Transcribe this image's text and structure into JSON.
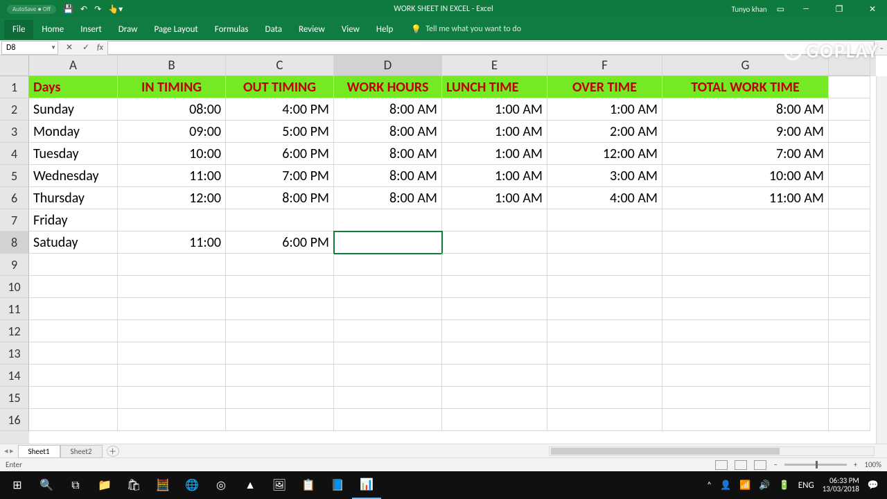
{
  "titlebar": {
    "autosave": "AutoSave ● Off",
    "doc_title": "WORK SHEET IN EXCEL - Excel",
    "user": "Tunyo khan"
  },
  "watermark": "GOPLAY",
  "ribbon": {
    "tabs": [
      "File",
      "Home",
      "Insert",
      "Draw",
      "Page Layout",
      "Formulas",
      "Data",
      "Review",
      "View",
      "Help"
    ],
    "tell_me": "Tell me what you want to do"
  },
  "formula": {
    "name_box": "D8",
    "fx": "fx"
  },
  "columns": [
    "A",
    "B",
    "C",
    "D",
    "E",
    "F",
    "G"
  ],
  "selected_col": "D",
  "selected_row": "8",
  "selected_cell": "D8",
  "row_count": 16,
  "headers": [
    "Days",
    "IN TIMING",
    "OUT TIMING",
    "WORK HOURS",
    "LUNCH TIME",
    "OVER TIME",
    "TOTAL WORK TIME"
  ],
  "rows": [
    {
      "A": "Sunday",
      "B": "08:00",
      "C": "4:00 PM",
      "D": "8:00 AM",
      "E": "1:00 AM",
      "F": "1:00 AM",
      "G": "8:00 AM"
    },
    {
      "A": "Monday",
      "B": "09:00",
      "C": "5:00 PM",
      "D": "8:00 AM",
      "E": "1:00 AM",
      "F": "2:00 AM",
      "G": "9:00 AM"
    },
    {
      "A": "Tuesday",
      "B": "10:00",
      "C": "6:00 PM",
      "D": "8:00 AM",
      "E": "1:00 AM",
      "F": "12:00 AM",
      "G": "7:00 AM"
    },
    {
      "A": "Wednesday",
      "B": "11:00",
      "C": "7:00 PM",
      "D": "8:00 AM",
      "E": "1:00 AM",
      "F": "3:00 AM",
      "G": "10:00 AM"
    },
    {
      "A": "Thursday",
      "B": "12:00",
      "C": "8:00 PM",
      "D": "8:00 AM",
      "E": "1:00 AM",
      "F": "4:00 AM",
      "G": "11:00 AM"
    },
    {
      "A": "Friday",
      "B": "",
      "C": "",
      "D": "",
      "E": "",
      "F": "",
      "G": ""
    },
    {
      "A": "Satuday",
      "B": "11:00",
      "C": "6:00 PM",
      "D": "",
      "E": "",
      "F": "",
      "G": ""
    }
  ],
  "sheets": {
    "active": "Sheet1",
    "list": [
      "Sheet1",
      "Sheet2"
    ]
  },
  "status": {
    "mode": "Enter",
    "zoom": "100%"
  },
  "taskbar": {
    "time": "06:33 PM",
    "date": "13/03/2018"
  }
}
